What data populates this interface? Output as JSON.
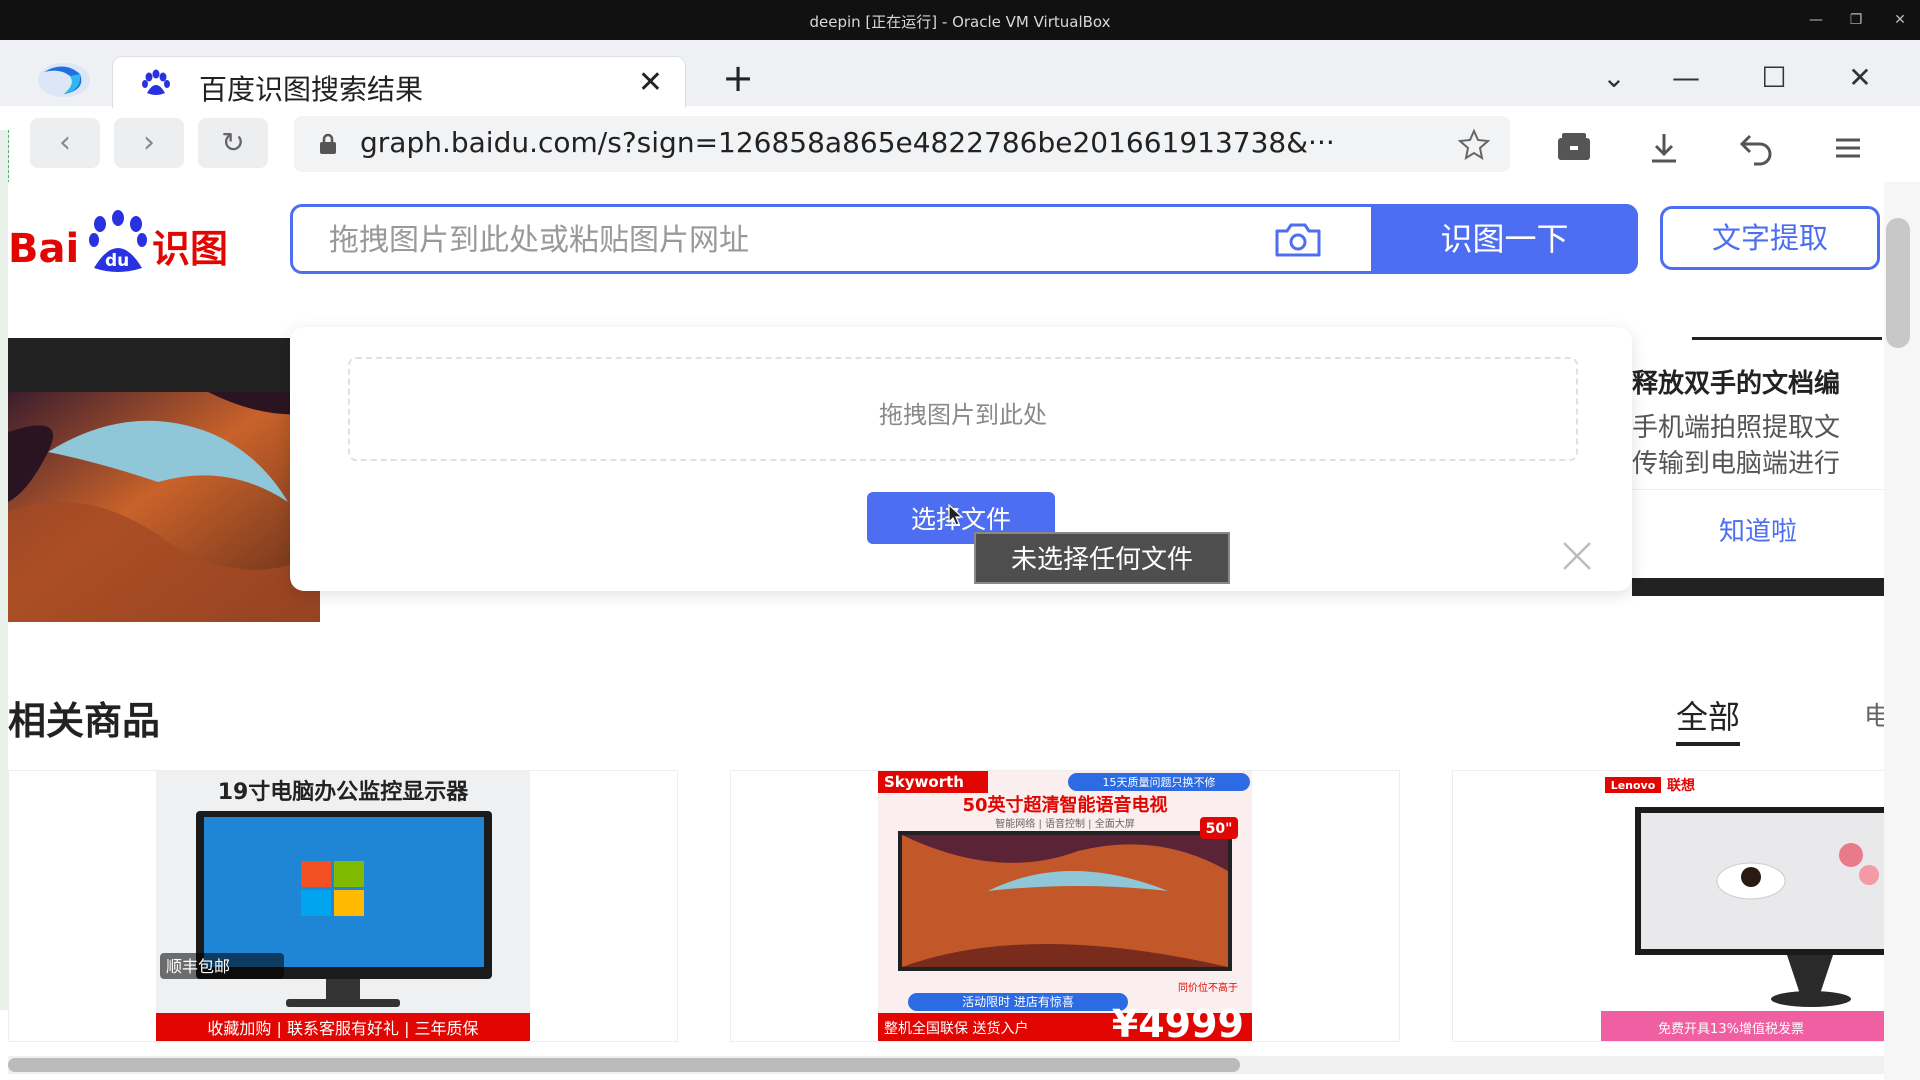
{
  "vbox": {
    "title": "deepin [正在运行] - Oracle VM VirtualBox"
  },
  "browser": {
    "tab": {
      "title": "百度识图搜索结果"
    },
    "address": {
      "url": "graph.baidu.com/s?sign=126858a865e4822786be201661913738&···"
    }
  },
  "page": {
    "search": {
      "placeholder": "拖拽图片到此处或粘贴图片网址",
      "button_label": "识图一下"
    },
    "text_extract_label": "文字提取",
    "upload_popup": {
      "drop_text": "拖拽图片到此处",
      "choose_file_label": "选择文件",
      "tooltip": "未选择任何文件"
    },
    "tip_card": {
      "title": "释放双手的文档编",
      "line1": "手机端拍照提取文",
      "line2": "传输到电脑端进行",
      "ok_label": "知道啦"
    },
    "related": {
      "title": "相关商品",
      "tab_all": "全部",
      "tab_more": "电",
      "products": [
        {
          "headline": "19寸电脑办公监控显示器",
          "badge": "顺丰包邮",
          "footer": "收藏加购 | 联系客服有好礼 | 三年质保"
        },
        {
          "brand": "Skyworth",
          "top_badge": "15天质量问题只换不修",
          "headline": "50英寸超清智能语音电视",
          "subline": "智能网络 | 语音控制 | 全面大屏",
          "size_badge": "50\"",
          "banner": "活动限时 进店有惊喜",
          "footer": "整机全国联保 送货入户",
          "price_note": "同价位不高于",
          "price": "¥4999"
        },
        {
          "brand": "Lenovo",
          "brand_cn": "联想",
          "footer": "免费开具13%增值税发票"
        }
      ]
    }
  },
  "colors": {
    "brand_blue": "#4e6ef2",
    "baidu_red": "#e10602",
    "dark": "#222222"
  }
}
